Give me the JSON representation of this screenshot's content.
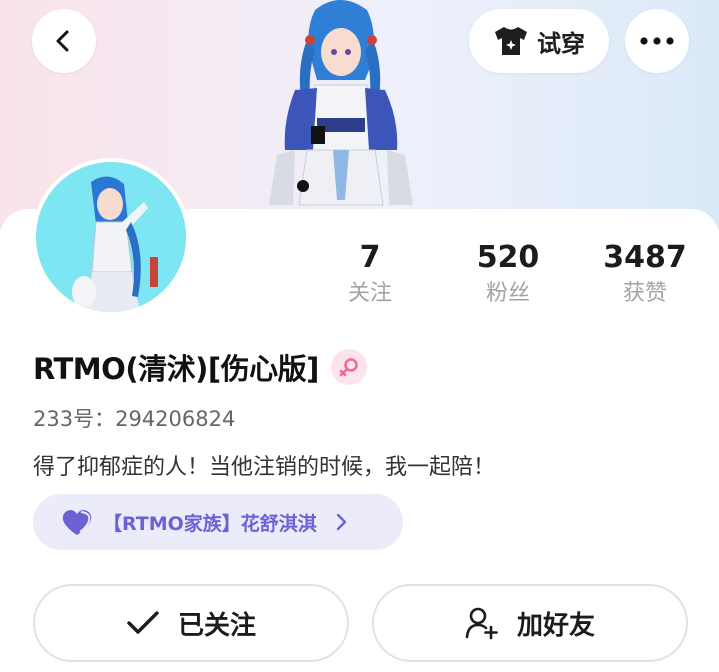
{
  "header": {
    "back_icon": "chevron-left-icon",
    "tryon_icon": "tshirt-icon",
    "tryon_label": "试穿",
    "more_icon": "more-dots-icon"
  },
  "profile": {
    "username": "RTMO(清沭)[伤心版]",
    "gender_icon": "female-icon",
    "uid_label": "233号：",
    "uid_value": "294206824",
    "bio": "得了抑郁症的人！当他注销的时候，我一起陪！"
  },
  "stats": [
    {
      "value": "7",
      "label": "关注"
    },
    {
      "value": "520",
      "label": "粉丝"
    },
    {
      "value": "3487",
      "label": "获赞"
    }
  ],
  "family": {
    "icon": "heart-icon",
    "name": "【RTMO家族】花舒淇淇",
    "chevron_icon": "chevron-right-icon"
  },
  "actions": {
    "follow_label": "已关注",
    "follow_icon": "check-icon",
    "add_friend_label": "加好友",
    "add_friend_icon": "user-plus-icon"
  },
  "colors": {
    "accent": "#6b62d4",
    "family_bg": "#ecebfa",
    "gender_bg": "#fde3ec",
    "gender_fg": "#f06a93"
  }
}
